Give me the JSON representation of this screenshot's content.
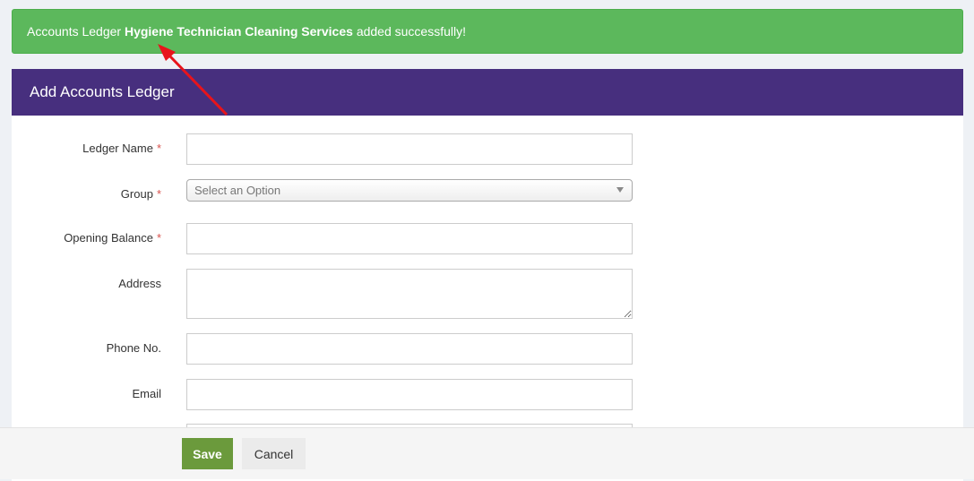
{
  "alert": {
    "prefix": "Accounts Ledger",
    "ledger_name": "Hygiene Technician Cleaning Services",
    "suffix": "added successfully!"
  },
  "panel": {
    "title": "Add Accounts Ledger"
  },
  "form": {
    "ledger_name_label": "Ledger Name",
    "ledger_name_value": "",
    "group_label": "Group",
    "group_placeholder": "Select an Option",
    "opening_balance_label": "Opening Balance",
    "opening_balance_value": "",
    "address_label": "Address",
    "phone_label": "Phone No.",
    "email_label": "Email",
    "required_marker": "*"
  },
  "footer": {
    "save_label": "Save",
    "cancel_label": "Cancel"
  },
  "colors": {
    "alert_bg": "#5cb85c",
    "header_bg": "#472f7e",
    "save_bg": "#6b9a3c",
    "annotation_arrow": "#e8141b"
  }
}
